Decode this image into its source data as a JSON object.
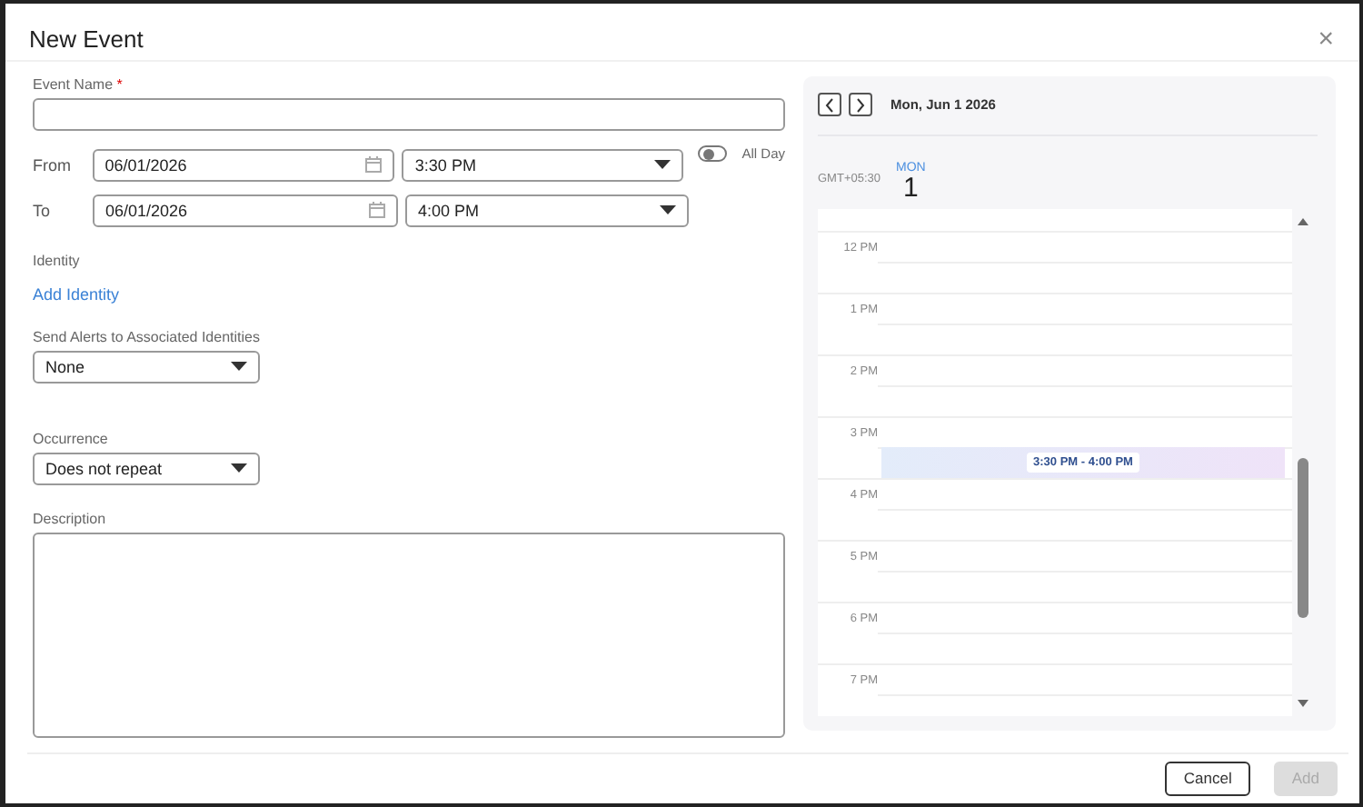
{
  "dialog": {
    "title": "New Event",
    "close": "×"
  },
  "form": {
    "event_name": {
      "label": "Event Name",
      "required_mark": "*"
    },
    "from": {
      "label": "From",
      "date": "06/01/2026",
      "time": "3:30 PM"
    },
    "to": {
      "label": "To",
      "date": "06/01/2026",
      "time": "4:00 PM"
    },
    "all_day": {
      "label": "All Day",
      "on": false
    },
    "identity": {
      "label": "Identity",
      "link": "Add Identity"
    },
    "alerts": {
      "label": "Send Alerts to Associated Identities",
      "value": "None"
    },
    "occurrence": {
      "label": "Occurrence",
      "value": "Does not repeat"
    },
    "description": {
      "label": "Description"
    }
  },
  "calendar": {
    "date_title": "Mon, Jun 1 2026",
    "timezone": "GMT+05:30",
    "day_name": "MON",
    "day_number": "1",
    "hours": [
      {
        "label": "12 PM"
      },
      {
        "label": "1 PM"
      },
      {
        "label": "2 PM"
      },
      {
        "label": "3 PM",
        "event": {
          "label": "3:30 PM - 4:00 PM",
          "starts_at_half": true
        }
      },
      {
        "label": "4 PM"
      },
      {
        "label": "5 PM"
      },
      {
        "label": "6 PM"
      },
      {
        "label": "7 PM"
      }
    ]
  },
  "buttons": [
    {
      "label": "Cancel",
      "disabled": false
    },
    {
      "label": "Add",
      "disabled": true
    }
  ]
}
